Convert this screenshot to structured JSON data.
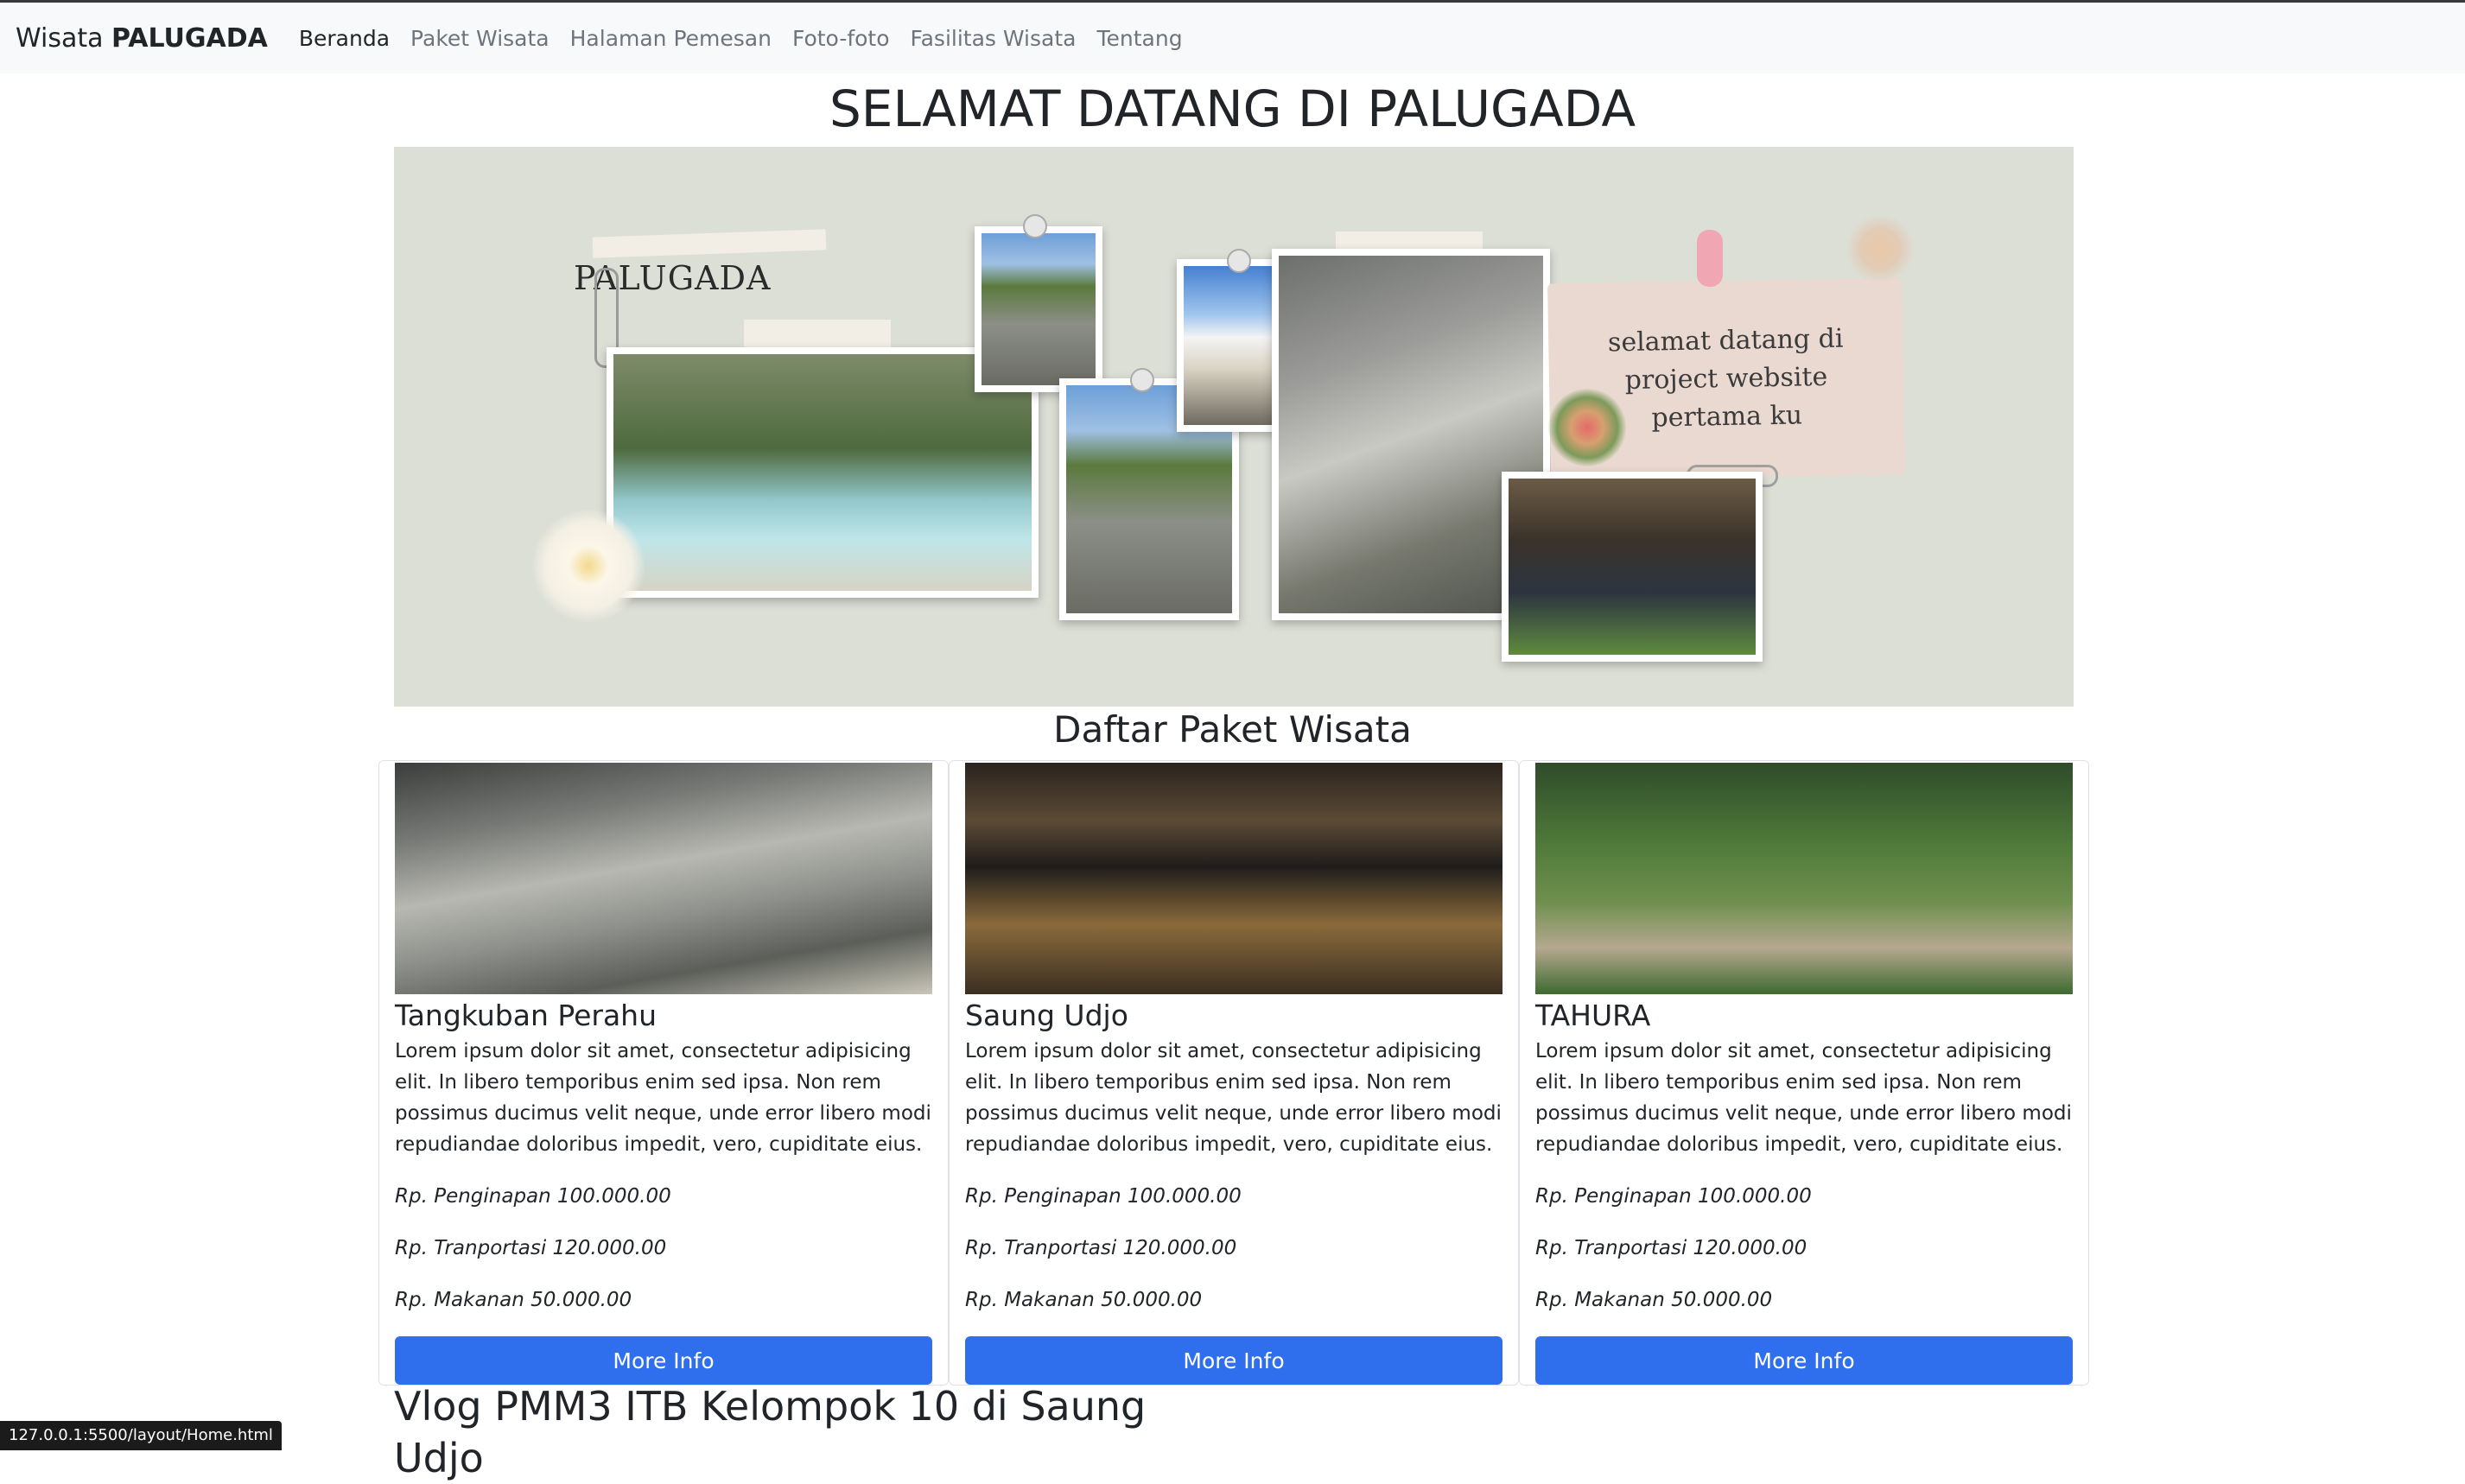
{
  "navbar": {
    "brand_prefix": "Wisata",
    "brand_name": "PALUGADA",
    "links": [
      "Beranda",
      "Paket Wisata",
      "Halaman Pemesan",
      "Foto-foto",
      "Fasilitas Wisata",
      "Tentang"
    ],
    "active": "Beranda"
  },
  "hero": {
    "title": "SELAMAT DATANG DI PALUGADA",
    "banner_label": "PALUGADA",
    "banner_note": "selamat datang di\nproject website\npertama ku"
  },
  "packages": {
    "title": "Daftar Paket Wisata",
    "cards": [
      {
        "title": "Tangkuban Perahu",
        "text": "Lorem ipsum dolor sit amet, consectetur adipisicing elit. In libero temporibus enim sed ipsa. Non rem possimus ducimus velit neque, unde error libero modi repudiandae doloribus impedit, vero, cupiditate eius.",
        "price_lodging": "Rp. Penginapan 100.000.00",
        "price_transport": "Rp. Tranportasi 120.000.00",
        "price_food": "Rp. Makanan 50.000.00",
        "button": "More Info"
      },
      {
        "title": "Saung Udjo",
        "text": "Lorem ipsum dolor sit amet, consectetur adipisicing elit. In libero temporibus enim sed ipsa. Non rem possimus ducimus velit neque, unde error libero modi repudiandae doloribus impedit, vero, cupiditate eius.",
        "price_lodging": "Rp. Penginapan 100.000.00",
        "price_transport": "Rp. Tranportasi 120.000.00",
        "price_food": "Rp. Makanan 50.000.00",
        "button": "More Info"
      },
      {
        "title": "TAHURA",
        "text": "Lorem ipsum dolor sit amet, consectetur adipisicing elit. In libero temporibus enim sed ipsa. Non rem possimus ducimus velit neque, unde error libero modi repudiandae doloribus impedit, vero, cupiditate eius.",
        "price_lodging": "Rp. Penginapan 100.000.00",
        "price_transport": "Rp. Tranportasi 120.000.00",
        "price_food": "Rp. Makanan 50.000.00",
        "button": "More Info"
      }
    ]
  },
  "vlog": {
    "title": "Vlog PMM3 ITB Kelompok 10 di Saung Udjo"
  },
  "status_bar": {
    "url": "127.0.0.1:5500/layout/Home.html"
  },
  "colors": {
    "primary_button": "#2f6fed",
    "navbar_bg": "#f8f9fa",
    "banner_bg": "#dcdfd6"
  }
}
